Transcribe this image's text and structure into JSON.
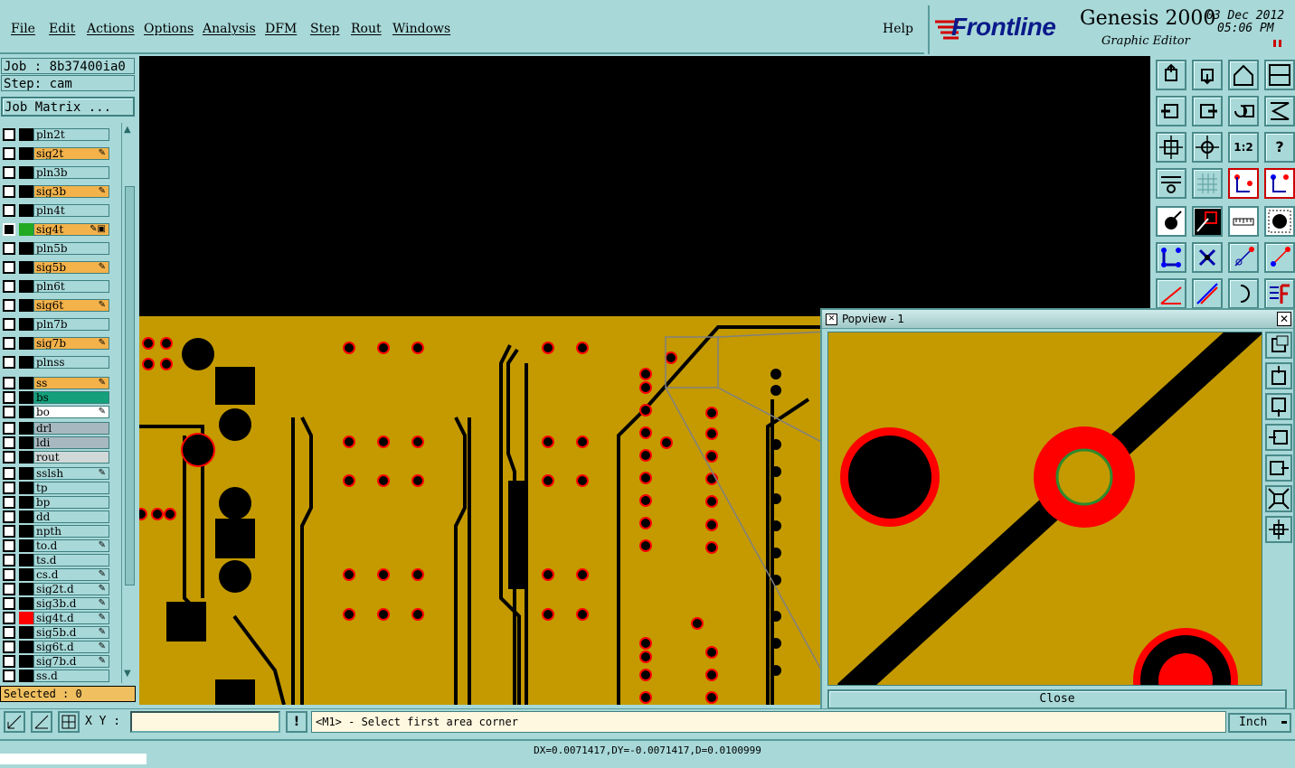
{
  "menu": {
    "items": [
      "File",
      "Edit",
      "Actions",
      "Options",
      "Analysis",
      "DFM",
      "Step",
      "Rout",
      "Windows"
    ],
    "help": "Help"
  },
  "brand": {
    "logo": "Frontline",
    "product": "Genesis 2000",
    "subtitle": "Graphic Editor",
    "date": "03 Dec 2012",
    "time": "05:06 PM"
  },
  "left": {
    "job": "Job : 8b37400ia0",
    "step": "Step: cam",
    "job_matrix": "Job Matrix ...",
    "selected": "Selected : 0"
  },
  "layers": [
    {
      "name": "pln2t",
      "color": "#a8d8d8",
      "mark": ""
    },
    {
      "name": "sig2t",
      "color": "#f4b24a",
      "mark": "✎"
    },
    {
      "name": "pln3b",
      "color": "#a8d8d8",
      "mark": ""
    },
    {
      "name": "sig3b",
      "color": "#f4b24a",
      "mark": "✎"
    },
    {
      "name": "pln4t",
      "color": "#a8d8d8",
      "mark": ""
    },
    {
      "name": "sig4t",
      "color": "#f4b24a",
      "mark": "✎▣",
      "active": true
    },
    {
      "name": "pln5b",
      "color": "#a8d8d8",
      "mark": ""
    },
    {
      "name": "sig5b",
      "color": "#f4b24a",
      "mark": "✎"
    },
    {
      "name": "pln6t",
      "color": "#a8d8d8",
      "mark": ""
    },
    {
      "name": "sig6t",
      "color": "#f4b24a",
      "mark": "✎"
    },
    {
      "name": "pln7b",
      "color": "#a8d8d8",
      "mark": ""
    },
    {
      "name": "sig7b",
      "color": "#f4b24a",
      "mark": "✎"
    },
    {
      "name": "plnss",
      "color": "#a8d8d8",
      "mark": ""
    },
    {
      "name": "ss",
      "color": "#f4b24a",
      "mark": "✎"
    },
    {
      "name": "bs",
      "color": "#13a07a",
      "mark": ""
    },
    {
      "name": "bo",
      "color": "#ffffff",
      "mark": "✎"
    },
    {
      "name": "drl",
      "color": "#a8b8c0",
      "mark": ""
    },
    {
      "name": "ldi",
      "color": "#a8b8c0",
      "mark": ""
    },
    {
      "name": "rout",
      "color": "#d0d8d8",
      "mark": ""
    },
    {
      "name": "sslsh",
      "color": "#a8d8d8",
      "mark": "✎"
    },
    {
      "name": "tp",
      "color": "#a8d8d8",
      "mark": ""
    },
    {
      "name": "bp",
      "color": "#a8d8d8",
      "mark": ""
    },
    {
      "name": "dd",
      "color": "#a8d8d8",
      "mark": ""
    },
    {
      "name": "npth",
      "color": "#a8d8d8",
      "mark": ""
    },
    {
      "name": "to.d",
      "color": "#a8d8d8",
      "mark": "✎"
    },
    {
      "name": "ts.d",
      "color": "#a8d8d8",
      "mark": ""
    },
    {
      "name": "cs.d",
      "color": "#a8d8d8",
      "mark": "✎"
    },
    {
      "name": "sig2t.d",
      "color": "#a8d8d8",
      "mark": "✎"
    },
    {
      "name": "sig3b.d",
      "color": "#a8d8d8",
      "mark": "✎"
    },
    {
      "name": "sig4t.d",
      "color": "#a8d8d8",
      "mark": "✎",
      "red": true
    },
    {
      "name": "sig5b.d",
      "color": "#a8d8d8",
      "mark": "✎"
    },
    {
      "name": "sig6t.d",
      "color": "#a8d8d8",
      "mark": "✎"
    },
    {
      "name": "sig7b.d",
      "color": "#a8d8d8",
      "mark": "✎"
    },
    {
      "name": "ss.d",
      "color": "#a8d8d8",
      "mark": ""
    }
  ],
  "popview": {
    "title": "Popview - 1",
    "close_label": "Close",
    "close_x": "✕"
  },
  "bottom": {
    "xy_label": "X Y :",
    "xy_value": "",
    "prompt": "<M1> - Select first area corner",
    "units": "Inch"
  },
  "status": {
    "measure": "DX=0.0071417,DY=-0.0071417,D=0.0100999"
  },
  "toolbar_labels": {
    "scale": "1:2",
    "help": "?"
  },
  "colors": {
    "panel": "#a8d8d8",
    "board": "#c49a00",
    "pad_ring": "#ff0000",
    "signal_layer": "#f4b24a",
    "copper_dark": "#000000"
  }
}
